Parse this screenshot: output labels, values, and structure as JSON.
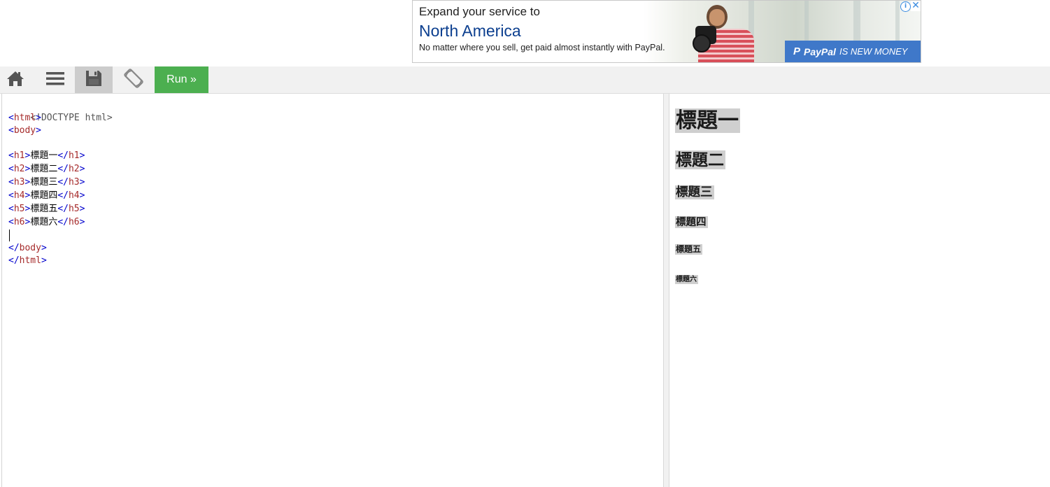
{
  "ad": {
    "line1": "Expand your service to",
    "line2": "North America",
    "line3": "No matter where you sell, get paid almost instantly with PayPal.",
    "brand_mark": "P",
    "brand_name": "PayPal",
    "brand_tagline": "IS NEW MONEY",
    "info_icon": "i",
    "close_icon": "✕",
    "colors": {
      "headline": "#0c3f8f",
      "brand_bar": "#3f78c9",
      "icons": "#3a8be0"
    }
  },
  "toolbar": {
    "icons": [
      "home-icon",
      "menu-icon",
      "save-icon",
      "rotate-icon"
    ],
    "run_label": "Run »",
    "run_color": "#4caf50"
  },
  "editor": {
    "lines": [
      {
        "text": "<!DOCTYPE html>"
      },
      {
        "open": "<",
        "tag": "html",
        "close": ">"
      },
      {
        "open": "<",
        "tag": "body",
        "close": ">"
      },
      {
        "text": ""
      },
      {
        "open": "<",
        "tag": "h1",
        "close": ">",
        "content": "標題一",
        "end_open": "</",
        "end_tag": "h1",
        "end_close": ">"
      },
      {
        "open": "<",
        "tag": "h2",
        "close": ">",
        "content": "標題二",
        "end_open": "</",
        "end_tag": "h2",
        "end_close": ">"
      },
      {
        "open": "<",
        "tag": "h3",
        "close": ">",
        "content": "標題三",
        "end_open": "</",
        "end_tag": "h3",
        "end_close": ">"
      },
      {
        "open": "<",
        "tag": "h4",
        "close": ">",
        "content": "標題四",
        "end_open": "</",
        "end_tag": "h4",
        "end_close": ">"
      },
      {
        "open": "<",
        "tag": "h5",
        "close": ">",
        "content": "標題五",
        "end_open": "</",
        "end_tag": "h5",
        "end_close": ">"
      },
      {
        "open": "<",
        "tag": "h6",
        "close": ">",
        "content": "標題六",
        "end_open": "</",
        "end_tag": "h6",
        "end_close": ">"
      },
      {
        "text": ""
      },
      {
        "open": "</",
        "tag": "body",
        "close": ">"
      },
      {
        "open": "</",
        "tag": "html",
        "close": ">"
      }
    ]
  },
  "result": {
    "headings": [
      "標題一",
      "標題二",
      "標題三",
      "標題四",
      "標題五",
      "標題六"
    ]
  }
}
